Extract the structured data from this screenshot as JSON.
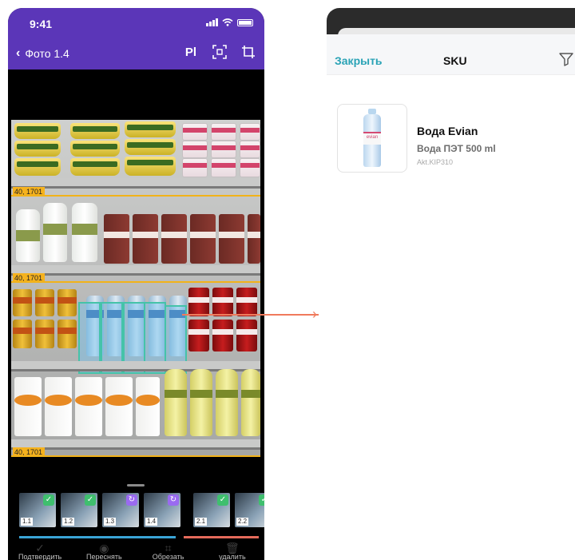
{
  "status_bar": {
    "time": "9:41"
  },
  "photo_screen": {
    "back_label": "Фото 1.4",
    "tools": [
      "Pl",
      "frame-icon",
      "crop-icon"
    ],
    "price_tags": [
      "40, 1701",
      "40, 1701",
      "40, 1701"
    ],
    "thumbnails": [
      {
        "label": "1.1",
        "status": "check"
      },
      {
        "label": "1.2",
        "status": "check"
      },
      {
        "label": "1.3",
        "status": "refresh"
      },
      {
        "label": "1.4",
        "status": "refresh"
      },
      {
        "label": "2.1",
        "status": "check"
      },
      {
        "label": "2.2",
        "status": "check"
      }
    ],
    "actions": [
      "Подтвердить",
      "Переснять",
      "Обрезать",
      "удалить"
    ]
  },
  "sku_panel": {
    "close_label": "Закрыть",
    "title": "SKU",
    "product": {
      "name": "Вода Evian",
      "subtitle": "Вода ПЭТ 500 ml",
      "code": "Akt.KIP310",
      "brand_on_label": "evian"
    }
  },
  "colors": {
    "header_purple": "#5b36b8",
    "accent_teal": "#2aa3b6",
    "connector": "#f07a5c",
    "highlight_border": "#45c3a9",
    "price_tag": "#f5b21e"
  }
}
